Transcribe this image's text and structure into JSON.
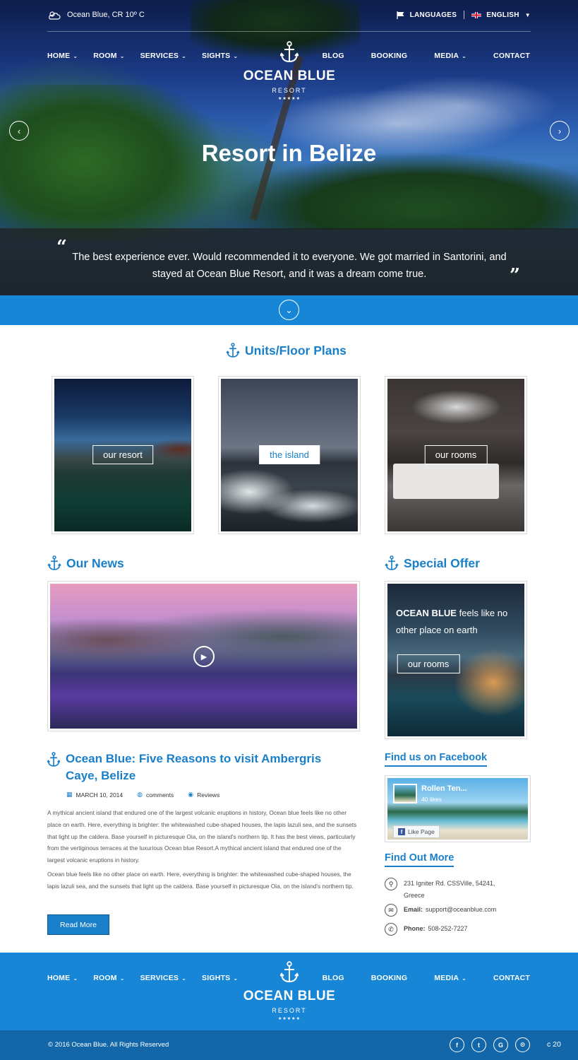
{
  "header": {
    "weather_text": "Ocean Blue, CR 10º C",
    "languages_label": "LANGUAGES",
    "language_selected": "ENGLISH"
  },
  "nav": {
    "left": [
      {
        "label": "HOME",
        "dropdown": true
      },
      {
        "label": "ROOM",
        "dropdown": true
      },
      {
        "label": "SERVICES",
        "dropdown": true
      },
      {
        "label": "SIGHTS",
        "dropdown": true
      }
    ],
    "right": [
      {
        "label": "BLOG",
        "dropdown": false
      },
      {
        "label": "BOOKING",
        "dropdown": false
      },
      {
        "label": "MEDIA",
        "dropdown": true
      },
      {
        "label": "CONTACT",
        "dropdown": false
      }
    ]
  },
  "logo": {
    "name": "OCEAN BLUE",
    "sub": "RESORT",
    "stars": "★★★★★"
  },
  "hero": {
    "title": "Resort in Belize",
    "quote": "The best experience ever. Would recommended it to everyone. We got married in Santorini, and stayed at Ocean Blue Resort, and it was a dream come true.",
    "prev_icon": "‹",
    "next_icon": "›",
    "down_icon": "⌄"
  },
  "units": {
    "title": "Units/Floor Plans",
    "cards": [
      {
        "label": "our resort"
      },
      {
        "label": "the island"
      },
      {
        "label": "our rooms"
      }
    ]
  },
  "news": {
    "title": "Our News",
    "post_title": "Ocean Blue: Five Reasons to visit Ambergris Caye,  Belize",
    "date": "MARCH 10, 2014",
    "comments": "comments",
    "reviews": "Reviews",
    "paragraph1": "A mythical ancient island that endured one of the largest volcanic eruptions in history, Ocean blue feels like no other place on earth. Here, everything is brighter: the whitewashed cube-shaped houses, the lapis lazuli sea, and the sunsets that light up the caldera. Base yourself in picturesque Oia, on the island's northern tip. It has the best views, particularly from the vertiginous terraces at the luxurious Ocean blue Resort.A mythical ancient island that endured one of the largest volcanic eruptions in history.",
    "paragraph2": "Ocean blue feels like no other place on earth. Here, everything is brighter: the whitewashed cube-shaped houses, the lapis lazuli sea, and the sunsets that light up the caldera. Base yourself in picturesque Oia, on the island's northern tip.",
    "read_more": "Read More"
  },
  "offer": {
    "title": "Special Offer",
    "brand": "OCEAN BLUE",
    "text": " feels like no other place on earth",
    "button": "our rooms"
  },
  "facebook": {
    "title": "Find us on Facebook",
    "page_name": "Rollen Ten...",
    "likes": "40 likes",
    "like_button": "Like Page"
  },
  "contact": {
    "title": "Find Out More",
    "address": "231 Igniter Rd. CSSVille, 54241, Greece",
    "email_label": "Email:",
    "email": "support@oceanblue.com",
    "phone_label": "Phone:",
    "phone": "508-252-7227"
  },
  "footer": {
    "copyright": "© 2016 Ocean Blue. All Rights Reserved",
    "code": "c 20",
    "social": [
      "f",
      "t",
      "G",
      "rss"
    ]
  },
  "colors": {
    "accent": "#1a7fc9",
    "footer_blue": "#1886d6",
    "copyright_blue": "#1367a8"
  }
}
